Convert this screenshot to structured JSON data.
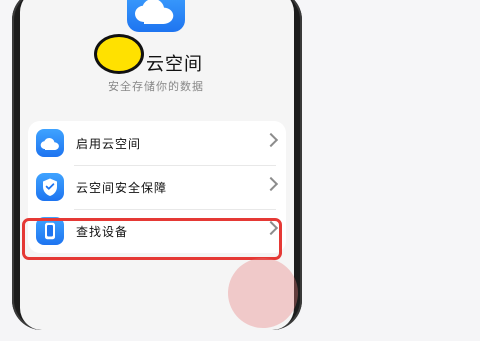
{
  "header": {
    "title": "云空间",
    "subtitle": "安全存储你的数据",
    "app_icon": "cloud-icon"
  },
  "list": {
    "items": [
      {
        "label": "启用云空间",
        "icon": "cloud-icon"
      },
      {
        "label": "云空间安全保障",
        "icon": "shield-icon"
      },
      {
        "label": "查找设备",
        "icon": "phone-icon"
      }
    ]
  },
  "colors": {
    "accent": "#1E74F0",
    "highlight": "#E53935",
    "marker": "#FFE100"
  }
}
